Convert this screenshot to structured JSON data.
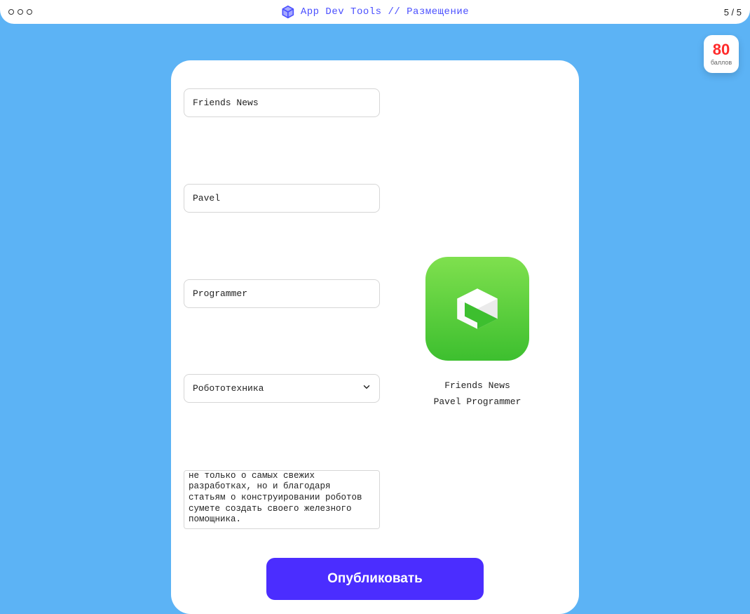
{
  "topbar": {
    "title": "App Dev Tools // Размещение",
    "page_counter": "5 / 5"
  },
  "score": {
    "value": "80",
    "label": "баллов"
  },
  "form": {
    "app_name": "Friends News",
    "first_name": "Pavel",
    "last_name": "Programmer",
    "category": "Робототехника",
    "description": "робототехники. Здесь вы узнаете не только о самых свежих разработках, но и благодаря статьям о конструировании роботов сумете создать своего железного помощника."
  },
  "preview": {
    "title": "Friends News",
    "subtitle": "Pavel Programmer"
  },
  "actions": {
    "publish_label": "Опубликовать"
  }
}
